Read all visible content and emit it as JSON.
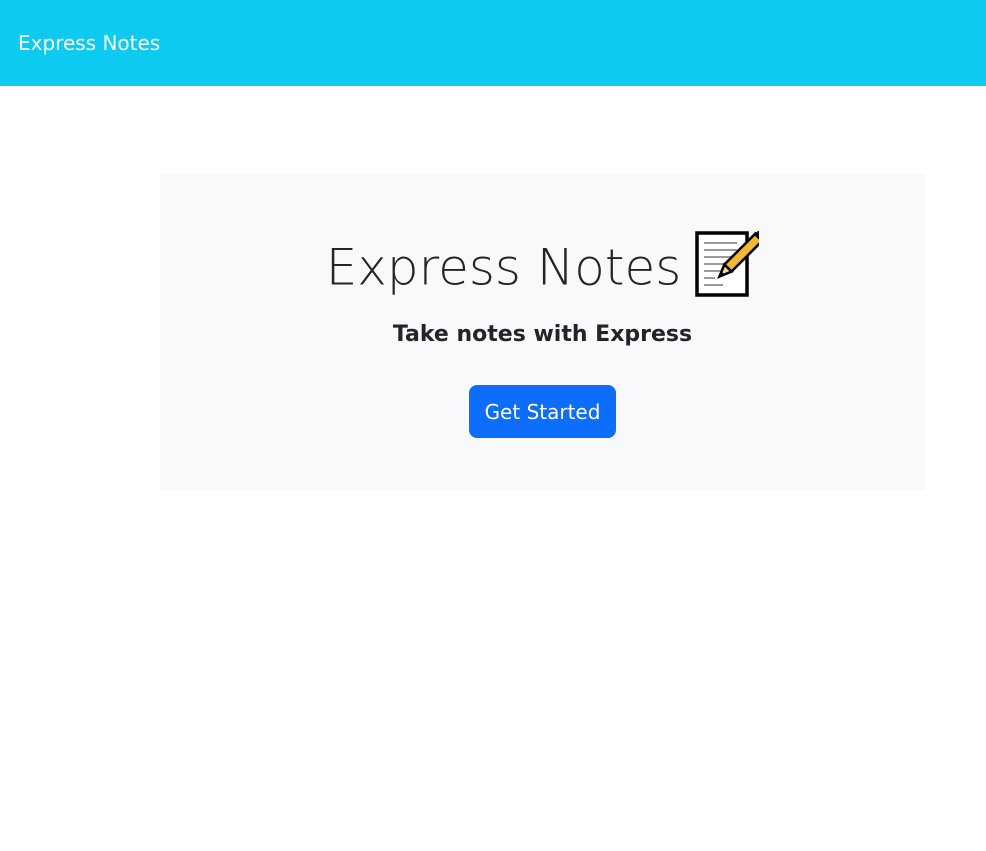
{
  "navbar": {
    "brand": "Express Notes"
  },
  "hero": {
    "title": "Express Notes",
    "icon": "memo-icon",
    "subtitle": "Take notes with Express",
    "cta_label": "Get Started"
  },
  "colors": {
    "navbar_bg": "#0dcaf0",
    "jumbotron_bg": "#f8f9fa",
    "button_bg": "#0d6efd",
    "text": "#212529"
  }
}
